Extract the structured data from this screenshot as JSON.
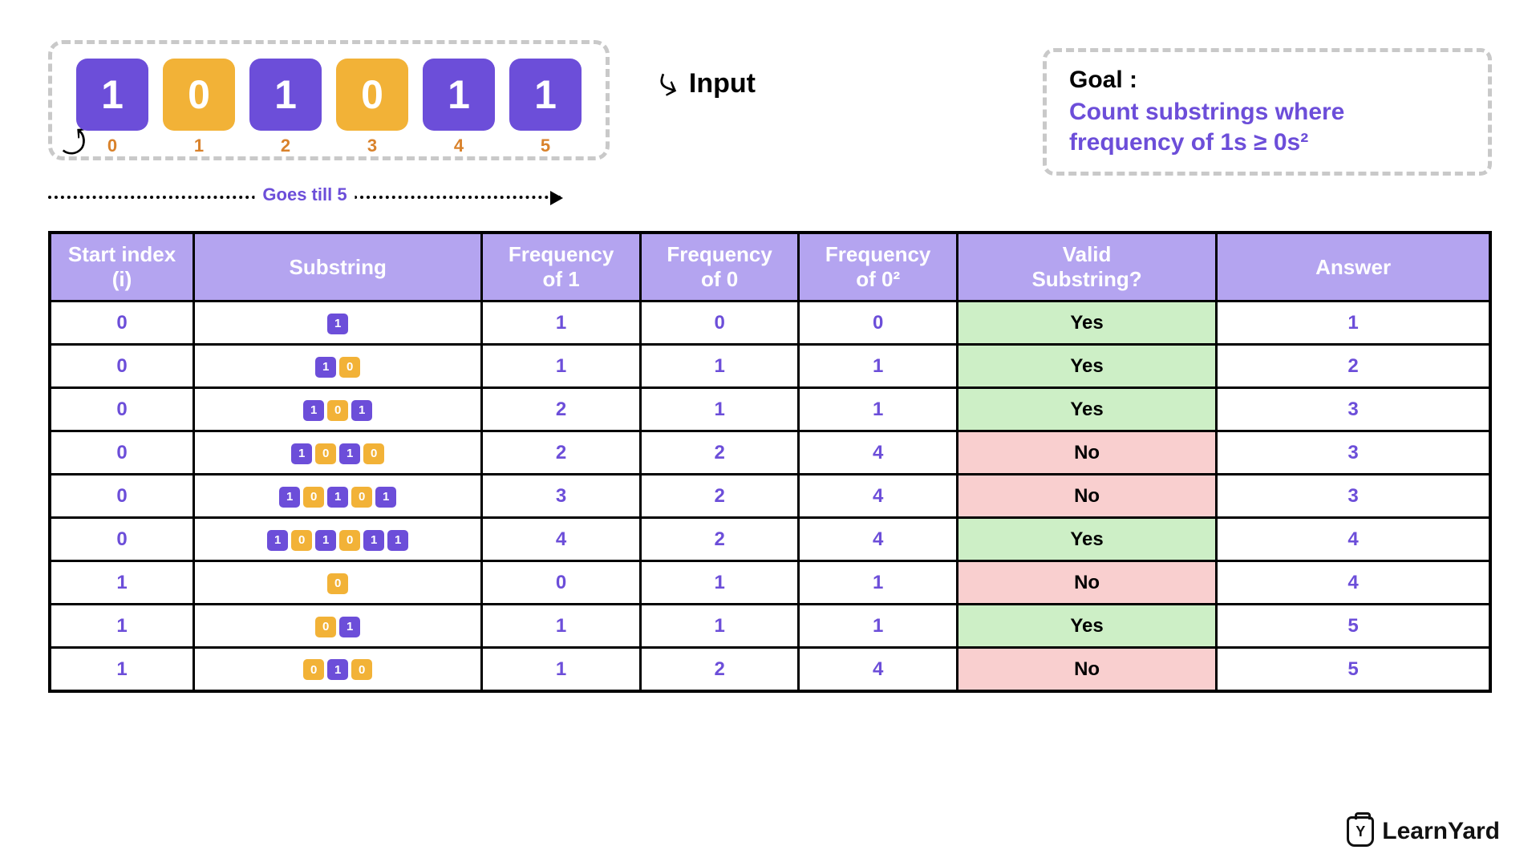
{
  "input": {
    "label": "Input",
    "bits": [
      {
        "value": "1",
        "color": "purple",
        "index": "0"
      },
      {
        "value": "0",
        "color": "orange",
        "index": "1"
      },
      {
        "value": "1",
        "color": "purple",
        "index": "2"
      },
      {
        "value": "0",
        "color": "orange",
        "index": "3"
      },
      {
        "value": "1",
        "color": "purple",
        "index": "4"
      },
      {
        "value": "1",
        "color": "purple",
        "index": "5"
      }
    ],
    "goes_till": "Goes till 5"
  },
  "goal": {
    "title": "Goal :",
    "text": "Count substrings where frequency of 1s ≥ 0s²"
  },
  "table": {
    "headers": [
      "Start index (i)",
      "Substring",
      "Frequency of 1",
      "Frequency of 0",
      "Frequency of 0²",
      "Valid Substring?",
      "Answer"
    ],
    "rows": [
      {
        "start": "0",
        "bits": [
          "1"
        ],
        "f1": "1",
        "f0": "0",
        "f0sq": "0",
        "valid": "Yes",
        "answer": "1"
      },
      {
        "start": "0",
        "bits": [
          "1",
          "0"
        ],
        "f1": "1",
        "f0": "1",
        "f0sq": "1",
        "valid": "Yes",
        "answer": "2"
      },
      {
        "start": "0",
        "bits": [
          "1",
          "0",
          "1"
        ],
        "f1": "2",
        "f0": "1",
        "f0sq": "1",
        "valid": "Yes",
        "answer": "3"
      },
      {
        "start": "0",
        "bits": [
          "1",
          "0",
          "1",
          "0"
        ],
        "f1": "2",
        "f0": "2",
        "f0sq": "4",
        "valid": "No",
        "answer": "3"
      },
      {
        "start": "0",
        "bits": [
          "1",
          "0",
          "1",
          "0",
          "1"
        ],
        "f1": "3",
        "f0": "2",
        "f0sq": "4",
        "valid": "No",
        "answer": "3"
      },
      {
        "start": "0",
        "bits": [
          "1",
          "0",
          "1",
          "0",
          "1",
          "1"
        ],
        "f1": "4",
        "f0": "2",
        "f0sq": "4",
        "valid": "Yes",
        "answer": "4"
      },
      {
        "start": "1",
        "bits": [
          "0"
        ],
        "f1": "0",
        "f0": "1",
        "f0sq": "1",
        "valid": "No",
        "answer": "4"
      },
      {
        "start": "1",
        "bits": [
          "0",
          "1"
        ],
        "f1": "1",
        "f0": "1",
        "f0sq": "1",
        "valid": "Yes",
        "answer": "5"
      },
      {
        "start": "1",
        "bits": [
          "0",
          "1",
          "0"
        ],
        "f1": "1",
        "f0": "2",
        "f0sq": "4",
        "valid": "No",
        "answer": "5"
      }
    ]
  },
  "logo": {
    "text": "LearnYard",
    "icon_letter": "Y"
  },
  "chart_data": {
    "type": "table",
    "input_string": "101011",
    "goal": "Count substrings where frequency of 1s >= (frequency of 0s)^2",
    "columns": [
      "Start index (i)",
      "Substring",
      "Frequency of 1",
      "Frequency of 0",
      "Frequency of 0²",
      "Valid Substring?",
      "Answer"
    ],
    "rows": [
      [
        0,
        "1",
        1,
        0,
        0,
        "Yes",
        1
      ],
      [
        0,
        "10",
        1,
        1,
        1,
        "Yes",
        2
      ],
      [
        0,
        "101",
        2,
        1,
        1,
        "Yes",
        3
      ],
      [
        0,
        "1010",
        2,
        2,
        4,
        "No",
        3
      ],
      [
        0,
        "10101",
        3,
        2,
        4,
        "No",
        3
      ],
      [
        0,
        "101011",
        4,
        2,
        4,
        "Yes",
        4
      ],
      [
        1,
        "0",
        0,
        1,
        1,
        "No",
        4
      ],
      [
        1,
        "01",
        1,
        1,
        1,
        "Yes",
        5
      ],
      [
        1,
        "010",
        1,
        2,
        4,
        "No",
        5
      ]
    ]
  }
}
